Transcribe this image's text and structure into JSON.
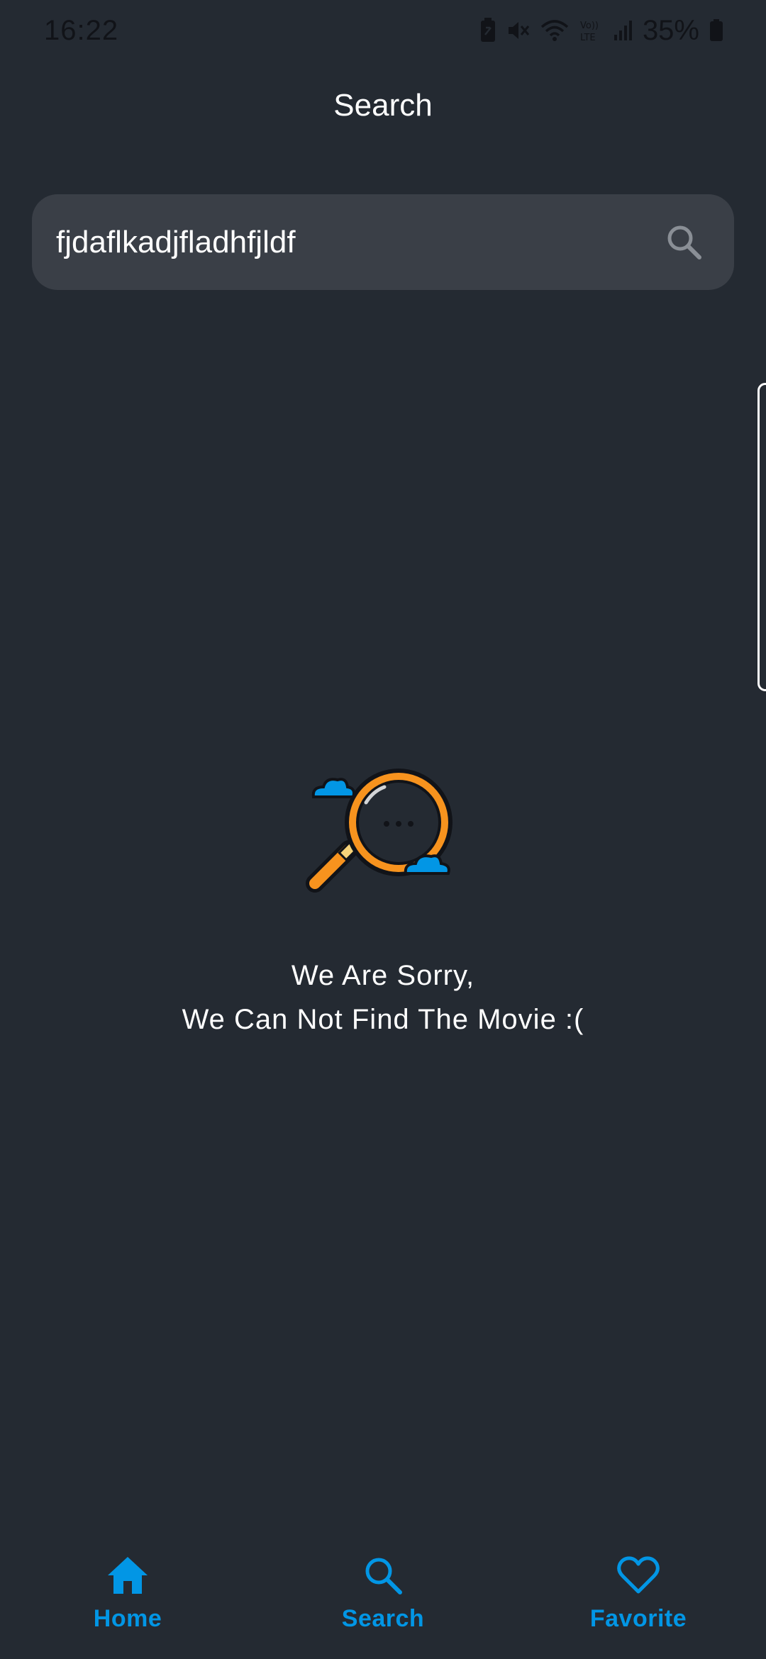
{
  "status_bar": {
    "time": "16:22",
    "battery_percent": "35%",
    "icons": [
      "battery-saver-icon",
      "mute-icon",
      "wifi-icon",
      "volte-icon",
      "signal-icon",
      "battery-icon"
    ]
  },
  "header": {
    "title": "Search"
  },
  "search": {
    "value": "fjdaflkadjfladhfjldf",
    "icon": "search-icon"
  },
  "empty_state": {
    "illustration": "magnifier-cloud-icon",
    "line1": "We Are Sorry,",
    "line2": "We Can Not Find The Movie :("
  },
  "bottom_nav": {
    "items": [
      {
        "label": "Home",
        "icon": "home-icon"
      },
      {
        "label": "Search",
        "icon": "search-icon"
      },
      {
        "label": "Favorite",
        "icon": "heart-icon"
      }
    ]
  },
  "colors": {
    "background": "#242a32",
    "search_bg": "#3a3f47",
    "accent": "#0296e5",
    "illustration_orange": "#f7931e"
  }
}
